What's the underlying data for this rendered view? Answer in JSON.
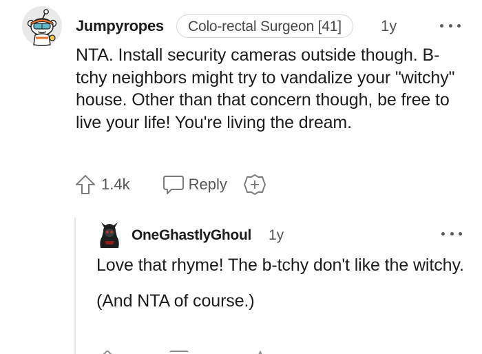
{
  "comment": {
    "author": "Jumpyropes",
    "flair": "Colo-rectal Surgeon [41]",
    "age": "1y",
    "body": "NTA. Install security cameras outside though. B-tchy neighbors might try to vandalize your \"witchy\" house. Other than that concern though, be free to live your life! You're living the dream.",
    "votes": "1.4k",
    "reply_label": "Reply",
    "avatar_icon": "snoo-avatar-icon"
  },
  "reply": {
    "author": "OneGhastlyGhoul",
    "age": "1y",
    "paragraphs": [
      "Love that rhyme! The b-tchy don't like the witchy.",
      "(And NTA of course.)"
    ],
    "avatar_icon": "ghoul-avatar-icon"
  },
  "colors": {
    "text": "#1c1c1c",
    "muted": "#555555",
    "border": "#d7d7d7"
  }
}
